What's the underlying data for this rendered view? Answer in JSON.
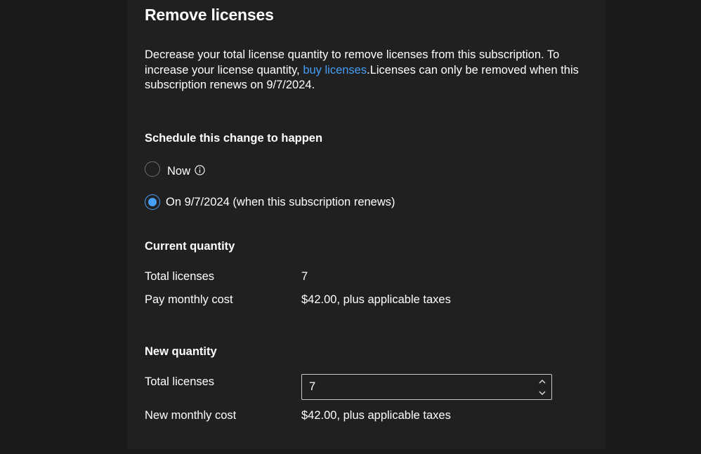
{
  "title": "Remove licenses",
  "description": {
    "before_link": "Decrease your total license quantity to remove licenses from this subscription. To increase your license quantity, ",
    "link_text": "buy licenses",
    "after_link": ".Licenses can only be removed when this subscription renews on 9/7/2024."
  },
  "schedule": {
    "heading": "Schedule this change to happen",
    "options": [
      {
        "label": "Now",
        "selected": false,
        "icon": "info-icon"
      },
      {
        "label": "On 9/7/2024 (when this subscription renews)",
        "selected": true
      }
    ]
  },
  "current_quantity": {
    "heading": "Current quantity",
    "rows": [
      {
        "label": "Total licenses",
        "value": "7"
      },
      {
        "label": "Pay monthly cost",
        "value": "$42.00, plus applicable taxes"
      }
    ]
  },
  "new_quantity": {
    "heading": "New quantity",
    "total_licenses_label": "Total licenses",
    "total_licenses_value": "7",
    "monthly_cost_label": "New monthly cost",
    "monthly_cost_value": "$42.00, plus applicable taxes",
    "spin_icons": [
      "chevron-up-icon",
      "chevron-down-icon"
    ]
  },
  "colors": {
    "background": "#1b1b1b",
    "panel": "#202020",
    "accent": "#479ef5",
    "text": "#ffffff"
  }
}
